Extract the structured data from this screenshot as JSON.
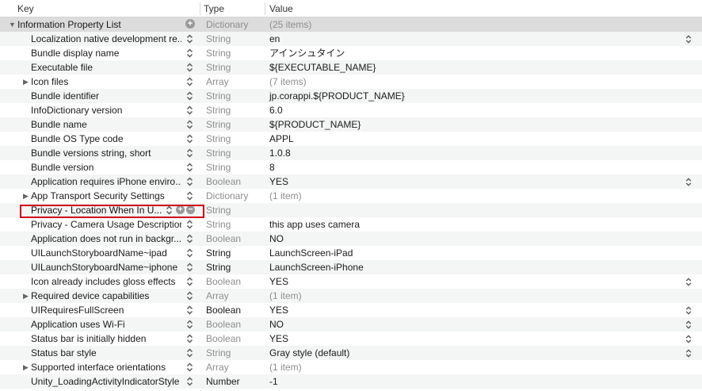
{
  "columns": {
    "key": "Key",
    "type": "Type",
    "value": "Value"
  },
  "rows": [
    {
      "key": "Information Property List",
      "type": "Dictionary",
      "value": "(25 items)",
      "root": true,
      "expanded": true,
      "type_muted": true,
      "value_muted": true
    },
    {
      "key": "Localization native development re...",
      "type": "String",
      "value": "en",
      "type_muted": true,
      "value_stepper": true
    },
    {
      "key": "Bundle display name",
      "type": "String",
      "value": "アインシュタイン",
      "type_muted": true
    },
    {
      "key": "Executable file",
      "type": "String",
      "value": "${EXECUTABLE_NAME}",
      "type_muted": true
    },
    {
      "key": "Icon files",
      "type": "Array",
      "value": "(7 items)",
      "collapsed": true,
      "type_muted": true,
      "value_muted": true
    },
    {
      "key": "Bundle identifier",
      "type": "String",
      "value": "jp.corappi.${PRODUCT_NAME}",
      "type_muted": true
    },
    {
      "key": "InfoDictionary version",
      "type": "String",
      "value": "6.0",
      "type_muted": true
    },
    {
      "key": "Bundle name",
      "type": "String",
      "value": "${PRODUCT_NAME}",
      "type_muted": true
    },
    {
      "key": "Bundle OS Type code",
      "type": "String",
      "value": "APPL",
      "type_muted": true
    },
    {
      "key": "Bundle versions string, short",
      "type": "String",
      "value": "1.0.8",
      "type_muted": true
    },
    {
      "key": "Bundle version",
      "type": "String",
      "value": "8",
      "type_muted": true
    },
    {
      "key": "Application requires iPhone enviro...",
      "type": "Boolean",
      "value": "YES",
      "type_muted": true,
      "value_stepper": true
    },
    {
      "key": "App Transport Security Settings",
      "type": "Dictionary",
      "value": "(1 item)",
      "collapsed": true,
      "type_muted": true,
      "value_muted": true
    },
    {
      "key": "Privacy - Location When In U...",
      "type": "String",
      "value": "",
      "editing": true,
      "type_muted": true
    },
    {
      "key": "Privacy - Camera Usage Description",
      "type": "String",
      "value": "this app uses camera",
      "type_muted": true
    },
    {
      "key": "Application does not run in backgr...",
      "type": "Boolean",
      "value": "NO",
      "type_muted": true
    },
    {
      "key": "UILaunchStoryboardName~ipad",
      "type": "String",
      "value": "LaunchScreen-iPad",
      "type_muted": false
    },
    {
      "key": "UILaunchStoryboardName~iphone",
      "type": "String",
      "value": "LaunchScreen-iPhone",
      "type_muted": false
    },
    {
      "key": "Icon already includes gloss effects",
      "type": "Boolean",
      "value": "YES",
      "type_muted": true,
      "value_stepper": true
    },
    {
      "key": "Required device capabilities",
      "type": "Array",
      "value": "(1 item)",
      "collapsed": true,
      "type_muted": true,
      "value_muted": true
    },
    {
      "key": "UIRequiresFullScreen",
      "type": "Boolean",
      "value": "YES",
      "type_muted": false,
      "value_stepper": true
    },
    {
      "key": "Application uses Wi-Fi",
      "type": "Boolean",
      "value": "NO",
      "type_muted": true,
      "value_stepper": true
    },
    {
      "key": "Status bar is initially hidden",
      "type": "Boolean",
      "value": "YES",
      "type_muted": true,
      "value_stepper": true
    },
    {
      "key": "Status bar style",
      "type": "String",
      "value": "Gray style (default)",
      "type_muted": true,
      "value_stepper": true
    },
    {
      "key": "Supported interface orientations",
      "type": "Array",
      "value": "(1 item)",
      "collapsed": true,
      "type_muted": true,
      "value_muted": true
    },
    {
      "key": "Unity_LoadingActivityIndicatorStyle",
      "type": "Number",
      "value": "-1",
      "type_muted": false
    }
  ]
}
